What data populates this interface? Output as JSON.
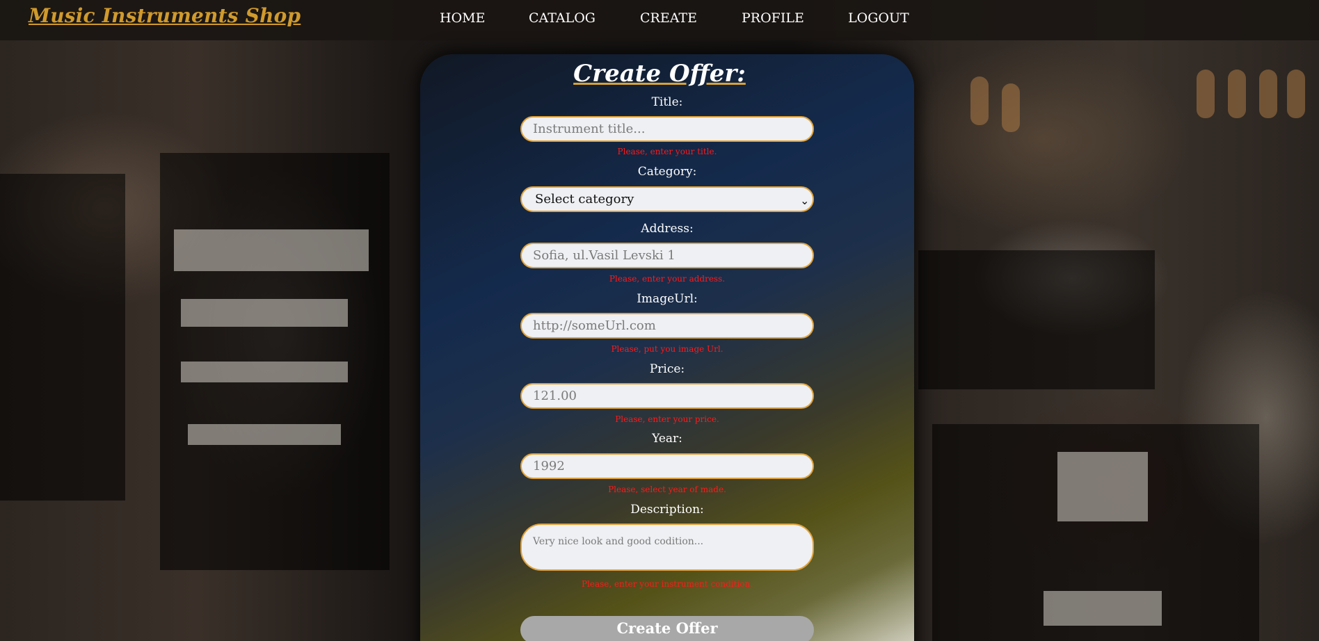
{
  "header": {
    "logo": "Music Instruments Shop",
    "nav": [
      "HOME",
      "CATALOG",
      "CREATE",
      "PROFILE",
      "LOGOUT"
    ]
  },
  "form": {
    "title": "Create Offer:",
    "fields": {
      "title": {
        "label": "Title:",
        "placeholder": "Instrument title...",
        "value": "",
        "error": "Please, enter your title."
      },
      "category": {
        "label": "Category:",
        "selected": "Select category"
      },
      "address": {
        "label": "Address:",
        "placeholder": "Sofia, ul.Vasil Levski 1",
        "value": "",
        "error": "Please, enter your address."
      },
      "image_url": {
        "label": "ImageUrl:",
        "placeholder": "http://someUrl.com",
        "value": "",
        "error": "Please, put you image Url."
      },
      "price": {
        "label": "Price:",
        "placeholder": "121.00",
        "value": "",
        "error": "Please, enter your price."
      },
      "year": {
        "label": "Year:",
        "placeholder": "1992",
        "value": "",
        "error": "Please, select year of made."
      },
      "description": {
        "label": "Description:",
        "placeholder": "Very nice look and good codition...",
        "value": "",
        "error": "Please, enter your instrument condition."
      }
    },
    "submit_label": "Create Offer"
  },
  "colors": {
    "accent": "#d09a2c",
    "field_border": "#e0a23a",
    "error": "#ff1a1a",
    "submit_bg": "#a8a8a8"
  },
  "icons": {
    "select_arrow": "chevron-down-icon"
  }
}
